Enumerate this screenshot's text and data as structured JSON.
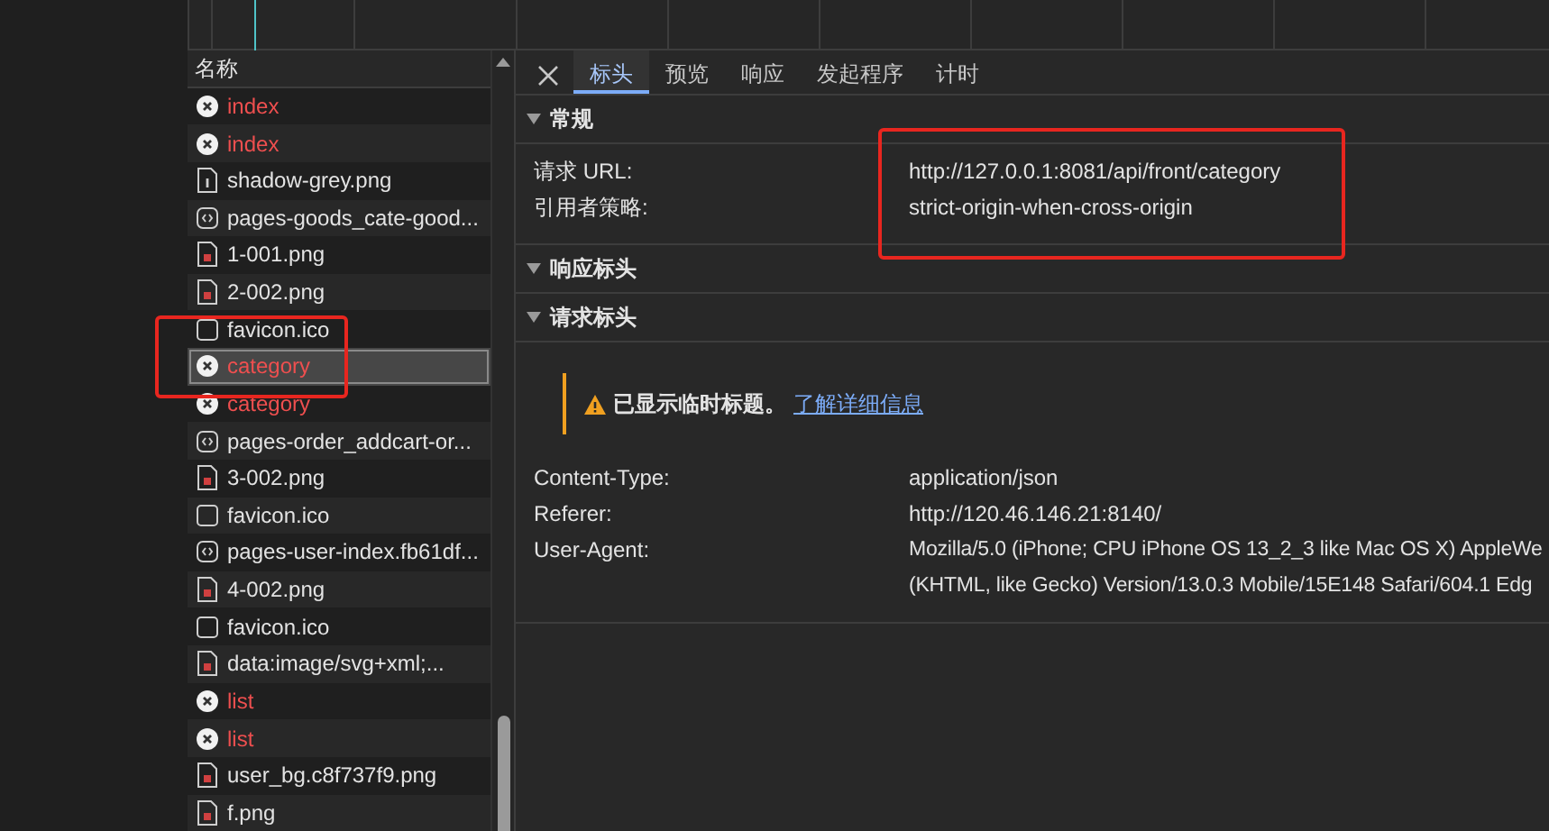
{
  "request_list": {
    "header": "名称",
    "rows": [
      {
        "name": "index",
        "kind": "error",
        "selected": false
      },
      {
        "name": "index",
        "kind": "error",
        "selected": false
      },
      {
        "name": "shadow-grey.png",
        "kind": "document",
        "selected": false
      },
      {
        "name": "pages-goods_cate-good...",
        "kind": "script",
        "selected": false
      },
      {
        "name": "1-001.png",
        "kind": "image",
        "selected": false
      },
      {
        "name": "2-002.png",
        "kind": "image",
        "selected": false
      },
      {
        "name": "favicon.ico",
        "kind": "blank",
        "selected": false
      },
      {
        "name": "category",
        "kind": "error",
        "selected": true
      },
      {
        "name": "category",
        "kind": "error",
        "selected": false
      },
      {
        "name": "pages-order_addcart-or...",
        "kind": "script",
        "selected": false
      },
      {
        "name": "3-002.png",
        "kind": "image",
        "selected": false
      },
      {
        "name": "favicon.ico",
        "kind": "blank",
        "selected": false
      },
      {
        "name": "pages-user-index.fb61df...",
        "kind": "script",
        "selected": false
      },
      {
        "name": "4-002.png",
        "kind": "image",
        "selected": false
      },
      {
        "name": "favicon.ico",
        "kind": "blank",
        "selected": false
      },
      {
        "name": "data:image/svg+xml;...",
        "kind": "image",
        "selected": false
      },
      {
        "name": "list",
        "kind": "error",
        "selected": false
      },
      {
        "name": "list",
        "kind": "error",
        "selected": false
      },
      {
        "name": "user_bg.c8f737f9.png",
        "kind": "image",
        "selected": false
      },
      {
        "name": "f.png",
        "kind": "image",
        "selected": false
      }
    ]
  },
  "tabs": [
    {
      "label": "标头",
      "selected": true
    },
    {
      "label": "预览",
      "selected": false
    },
    {
      "label": "响应",
      "selected": false
    },
    {
      "label": "发起程序",
      "selected": false
    },
    {
      "label": "计时",
      "selected": false
    }
  ],
  "sections": [
    {
      "title": "常规",
      "expanded": true,
      "rows": [
        {
          "key": "请求 URL:",
          "values": [
            "http://127.0.0.1:8081/api/front/category"
          ]
        },
        {
          "key": "引用者策略:",
          "values": [
            "strict-origin-when-cross-origin"
          ]
        }
      ]
    },
    {
      "title": "响应标头",
      "expanded": true
    },
    {
      "title": "请求标头",
      "expanded": true,
      "warning": {
        "text": "已显示临时标题。",
        "link": "了解详细信息"
      },
      "rows": [
        {
          "key": "Content-Type:",
          "values": [
            "application/json"
          ]
        },
        {
          "key": "Referer:",
          "values": [
            "http://120.46.146.21:8140/"
          ]
        },
        {
          "key": "User-Agent:",
          "values": [
            "Mozilla/5.0 (iPhone; CPU iPhone OS 13_2_3 like Mac OS X) AppleWe",
            "(KHTML, like Gecko) Version/13.0.3 Mobile/15E148 Safari/604.1 Edg"
          ]
        }
      ]
    }
  ]
}
